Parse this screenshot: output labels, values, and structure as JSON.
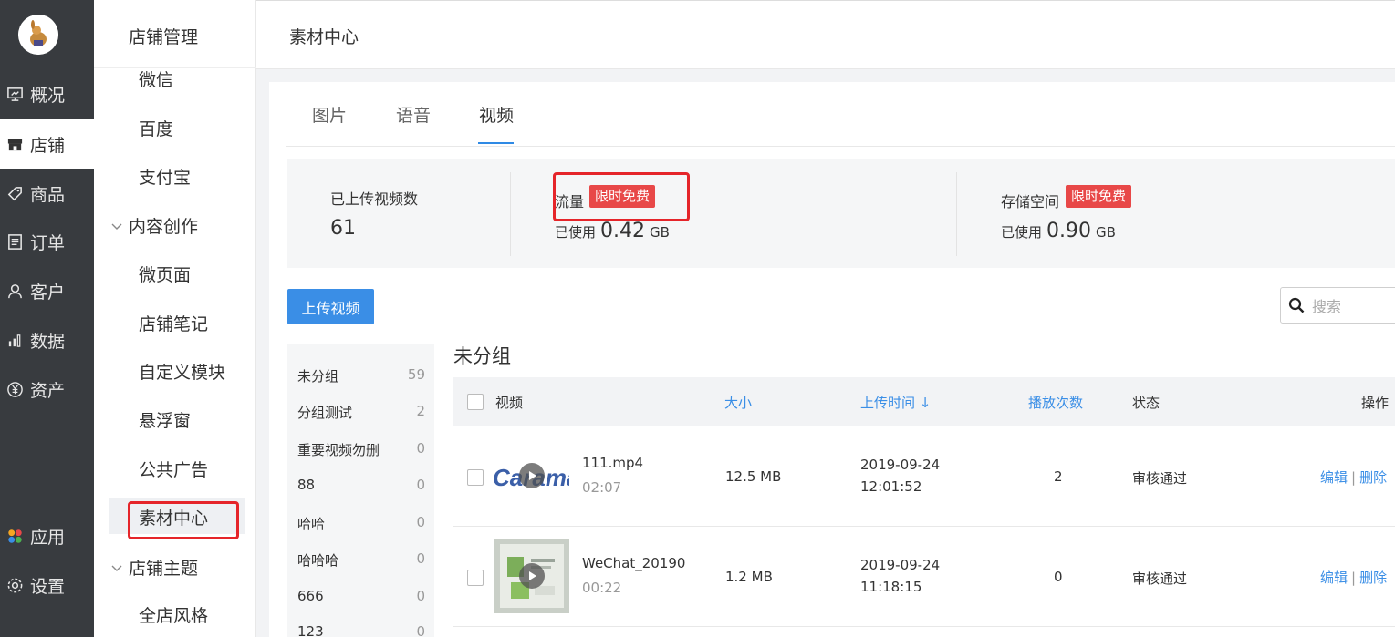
{
  "rail": {
    "items": [
      {
        "label": "概况",
        "icon": "overview-icon"
      },
      {
        "label": "店铺",
        "icon": "store-icon"
      },
      {
        "label": "商品",
        "icon": "tag-icon"
      },
      {
        "label": "订单",
        "icon": "order-icon"
      },
      {
        "label": "客户",
        "icon": "user-icon"
      },
      {
        "label": "数据",
        "icon": "chart-icon"
      },
      {
        "label": "资产",
        "icon": "yen-icon"
      },
      {
        "label": "应用",
        "icon": "apps-icon"
      },
      {
        "label": "设置",
        "icon": "gear-icon"
      }
    ]
  },
  "subnav": {
    "title": "店铺管理",
    "items": {
      "wechat": "微信",
      "baidu": "百度",
      "alipay": "支付宝",
      "content_group": "内容创作",
      "micro_page": "微页面",
      "store_notes": "店铺笔记",
      "custom_module": "自定义模块",
      "floating_window": "悬浮窗",
      "public_ads": "公共广告",
      "material_center": "素材中心",
      "theme_group": "店铺主题",
      "store_style": "全店风格"
    }
  },
  "header": {
    "title": "素材中心"
  },
  "tabs": [
    {
      "label": "图片"
    },
    {
      "label": "语音"
    },
    {
      "label": "视频"
    }
  ],
  "stats": {
    "uploaded_label": "已上传视频数",
    "uploaded_count": "61",
    "traffic_label": "流量",
    "traffic_badge": "限时免费",
    "traffic_used_prefix": "已使用",
    "traffic_used_value": "0.42",
    "traffic_used_unit": "GB",
    "storage_label": "存储空间",
    "storage_badge": "限时免费",
    "storage_used_prefix": "已使用",
    "storage_used_value": "0.90",
    "storage_used_unit": "GB"
  },
  "upload_button": "上传视频",
  "search": {
    "placeholder": "搜索"
  },
  "groups": [
    {
      "name": "未分组",
      "count": "59"
    },
    {
      "name": "分组测试",
      "count": "2"
    },
    {
      "name": "重要视频勿删",
      "count": "0"
    },
    {
      "name": "88",
      "count": "0"
    },
    {
      "name": "哈哈",
      "count": "0"
    },
    {
      "name": "哈哈哈",
      "count": "0"
    },
    {
      "name": "666",
      "count": "0"
    },
    {
      "name": "123",
      "count": "0"
    }
  ],
  "group_title": "未分组",
  "table": {
    "headers": {
      "video": "视频",
      "size": "大小",
      "upload_time": "上传时间 ↓",
      "plays": "播放次数",
      "status": "状态",
      "actions": "操作"
    },
    "rows": [
      {
        "name": "111.mp4",
        "duration": "02:07",
        "size": "12.5 MB",
        "date": "2019-09-24",
        "time": "12:01:52",
        "plays": "2",
        "status": "审核通过",
        "edit": "编辑",
        "delete": "删除"
      },
      {
        "name": "WeChat_20190",
        "duration": "00:22",
        "size": "1.2 MB",
        "date": "2019-09-24",
        "time": "11:18:15",
        "plays": "0",
        "status": "审核通过",
        "edit": "编辑",
        "delete": "删除"
      }
    ]
  },
  "colors": {
    "accent": "#3a8ee6",
    "badge": "#e84848",
    "highlight_box": "#e5252a",
    "rail": "#383b3f"
  }
}
